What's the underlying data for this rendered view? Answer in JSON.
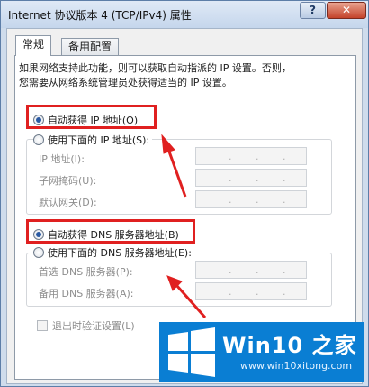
{
  "window": {
    "title": "Internet 协议版本 4 (TCP/IPv4) 属性",
    "help_label": "?",
    "close_label": "✕"
  },
  "tabs": [
    {
      "label": "常规"
    },
    {
      "label": "备用配置"
    }
  ],
  "description": {
    "line1": "如果网络支持此功能，则可以获取自动指派的 IP 设置。否则，",
    "line2": "您需要从网络系统管理员处获得适当的 IP 设置。"
  },
  "ip_section": {
    "auto_label": "自动获得 IP 地址(O)",
    "manual_label": "使用下面的 IP 地址(S):",
    "fields": [
      {
        "label": "IP 地址(I):"
      },
      {
        "label": "子网掩码(U):"
      },
      {
        "label": "默认网关(D):"
      }
    ]
  },
  "dns_section": {
    "auto_label": "自动获得 DNS 服务器地址(B)",
    "manual_label": "使用下面的 DNS 服务器地址(E):",
    "fields": [
      {
        "label": "首选 DNS 服务器(P):"
      },
      {
        "label": "备用 DNS 服务器(A):"
      }
    ]
  },
  "validate_label": "退出时验证设置(L)",
  "watermark": {
    "brand": "Win10 之家",
    "url": "www.win10xitong.com"
  },
  "colors": {
    "highlight": "#e02020",
    "logo_bg": "#0a7ed3"
  }
}
